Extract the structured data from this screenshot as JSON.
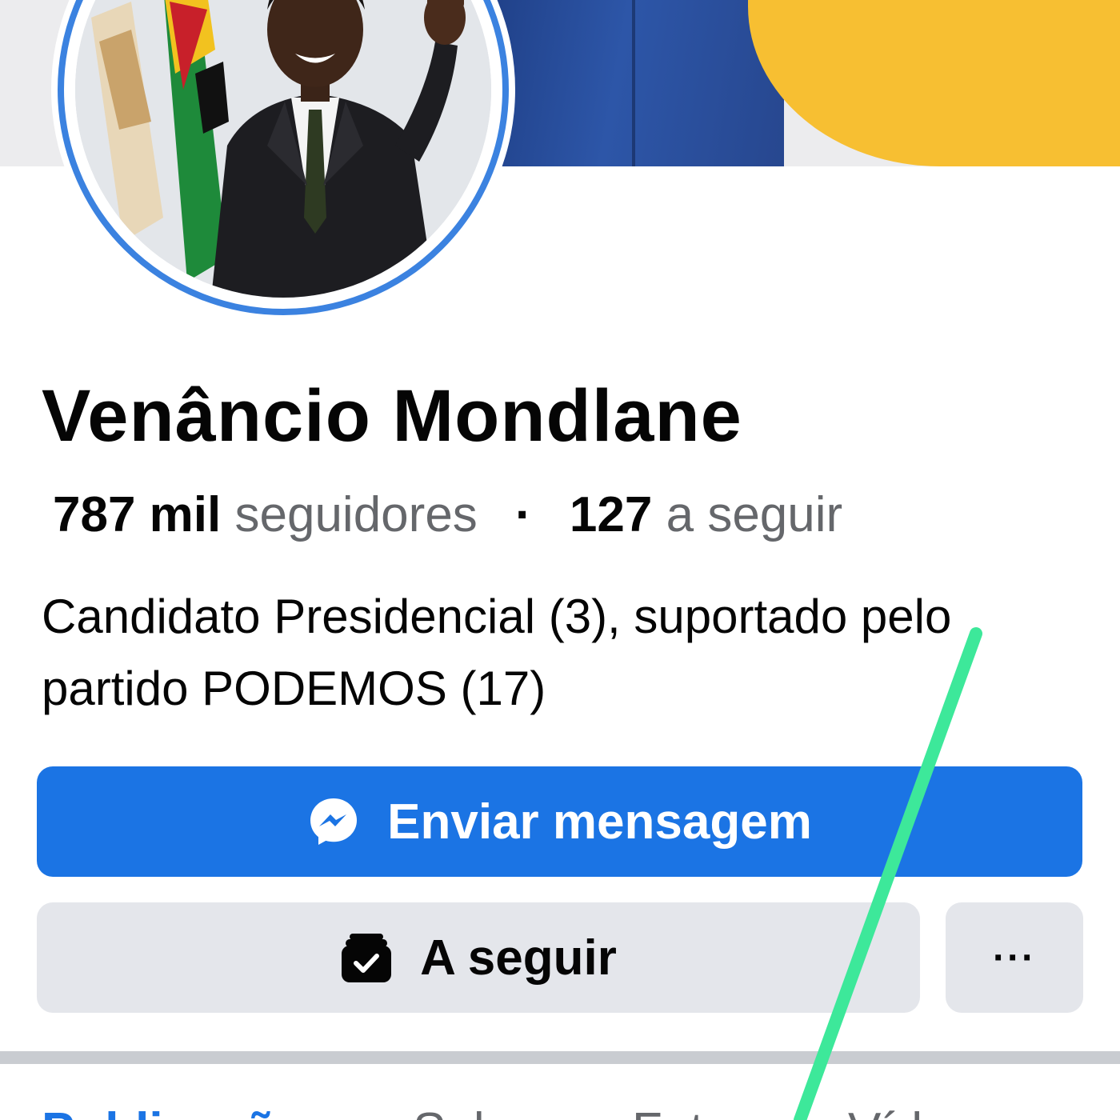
{
  "profile": {
    "name": "Venâncio Mondlane",
    "followers_count": "787 mil",
    "followers_label": "seguidores",
    "separator": "·",
    "following_count": "127",
    "following_label": "a seguir",
    "bio_line1": "Candidato Presidencial (3), suportado pelo",
    "bio_line2": "partido PODEMOS (17)"
  },
  "actions": {
    "message_label": "Enviar mensagem",
    "following_label": "A seguir",
    "more_label": "···"
  },
  "tabs": [
    {
      "label": "Publicações",
      "active": true
    },
    {
      "label": "Sobre",
      "active": false
    },
    {
      "label": "Fotos",
      "active": false
    },
    {
      "label": "Vídeos",
      "active": false
    }
  ],
  "colors": {
    "accent": "#1b74e4",
    "avatar_ring": "#3b82e0",
    "cover_yellow": "#f7bf32",
    "secondary_button": "#e4e6eb",
    "annotation_stroke": "#3de89a"
  },
  "icons": {
    "message_button": "messenger-icon",
    "following_button": "following-check-icon",
    "more_button": "more-dots-icon"
  }
}
